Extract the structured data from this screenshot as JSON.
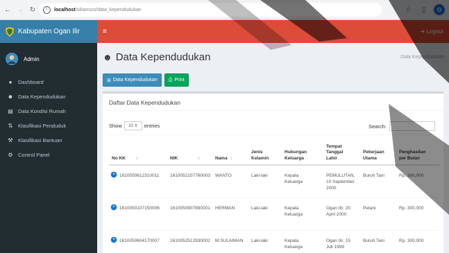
{
  "browser": {
    "url_host": "localhost",
    "url_path": "/sibansos/data_kependudukan"
  },
  "app": {
    "title": "Kabupaten Ogan Ilir",
    "logout_label": "Logout"
  },
  "user": {
    "name": "Admin"
  },
  "sidebar": {
    "items": [
      {
        "label": "Dashboard",
        "icon": "dashboard-icon"
      },
      {
        "label": "Data Kependudukan",
        "icon": "users-icon"
      },
      {
        "label": "Data Kondisi Rumah",
        "icon": "book-icon"
      },
      {
        "label": "Klasifikasi Penduduk",
        "icon": "sort-icon"
      },
      {
        "label": "Klasifikasi Bantuan",
        "icon": "wrench-icon"
      },
      {
        "label": "Control Panel",
        "icon": "gear-icon"
      }
    ]
  },
  "page": {
    "title": "Data Kependudukan",
    "breadcrumb": "Data Kependudukan",
    "add_button": "Data Kependudukan",
    "print_button": "Print",
    "box_title": "Daftar Data Kependudukan",
    "show_label": "Show",
    "entries_value": "10",
    "entries_label": "entries",
    "search_label": "Search:"
  },
  "table": {
    "headers": [
      "No KK",
      "NIK",
      "Nama",
      "Jenis\nKelamin",
      "Hubungan\nKeluarga",
      "Tempat\nTanggal\nLahir",
      "Pekerjaan\nUtama",
      "Penghasilan\nper Bulan"
    ],
    "rows": [
      [
        "1610050612310011",
        "1610052107760003",
        "WANTO",
        "Laki-laki",
        "Kepala\nKeluarga",
        "PEMULUTAN,\n10 September\n2000",
        "Buruh Tani",
        "Rp. 300,000"
      ],
      [
        "1610050107150006",
        "1610050907890001",
        "HERMAN",
        "Laki-laki",
        "Kepala\nKeluarga",
        "Ogan Ilir, 20\nApril 2000",
        "Petani",
        "Rp. 300,000"
      ],
      [
        "1610050604170007",
        "1610052512930002",
        "M.SULAIMAN",
        "Laki-laki",
        "Kepala\nKeluarga",
        "Ogan Ilir, 15\nJuli 1999",
        "Buruh Tani",
        "Rp. 300,000"
      ]
    ]
  },
  "colors": {
    "topbar": "#dd4b39",
    "sidebar": "#222d32",
    "logo_bar": "#367fa9",
    "primary": "#3c8dbc",
    "success": "#00a65a"
  }
}
